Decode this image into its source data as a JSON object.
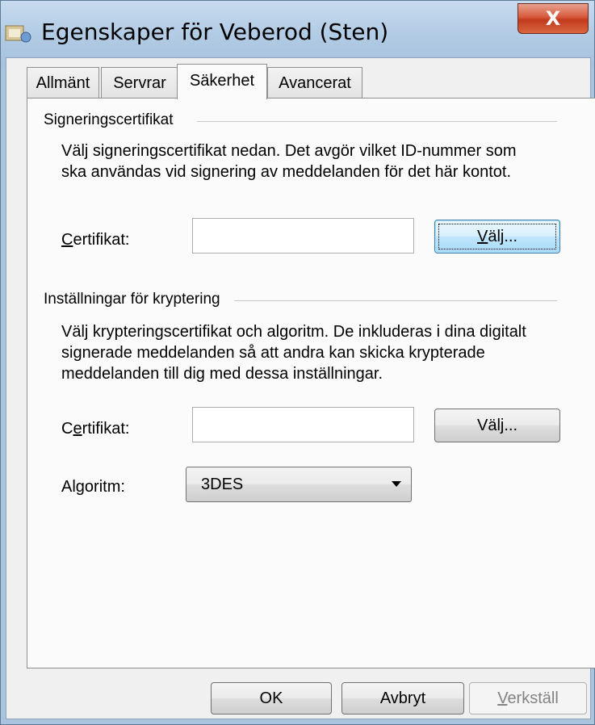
{
  "window": {
    "title": "Egenskaper för Veberod (Sten)",
    "close_glyph": "X"
  },
  "tabs": [
    {
      "label": "Allmänt",
      "active": false
    },
    {
      "label": "Servrar",
      "active": false
    },
    {
      "label": "Säkerhet",
      "active": true
    },
    {
      "label": "Avancerat",
      "active": false
    }
  ],
  "signing": {
    "group_label": "Signeringscertifikat",
    "description": "Välj signeringscertifikat nedan. Det avgör vilket ID-nummer som\nska användas vid signering av meddelanden för det här kontot.",
    "cert_label_first": "C",
    "cert_label_rest": "ertifikat:",
    "cert_value": "",
    "choose_button_first": "V",
    "choose_button_rest": "älj..."
  },
  "encryption": {
    "group_label": "Inställningar för kryptering",
    "description": "Välj krypteringscertifikat och algoritm. De inkluderas i dina digitalt\nsignerade meddelanden så att andra kan skicka krypterade\nmeddelanden till dig med dessa inställningar.",
    "cert_label_first": "C",
    "cert_label_underlined": "e",
    "cert_label_rest": "rtifikat:",
    "cert_value": "",
    "choose_button": "Välj...",
    "algorithm_label": "Algoritm:",
    "algorithm_value": "3DES"
  },
  "footer": {
    "ok": "OK",
    "cancel": "Avbryt",
    "apply_first": "V",
    "apply_rest": "erkställ"
  }
}
